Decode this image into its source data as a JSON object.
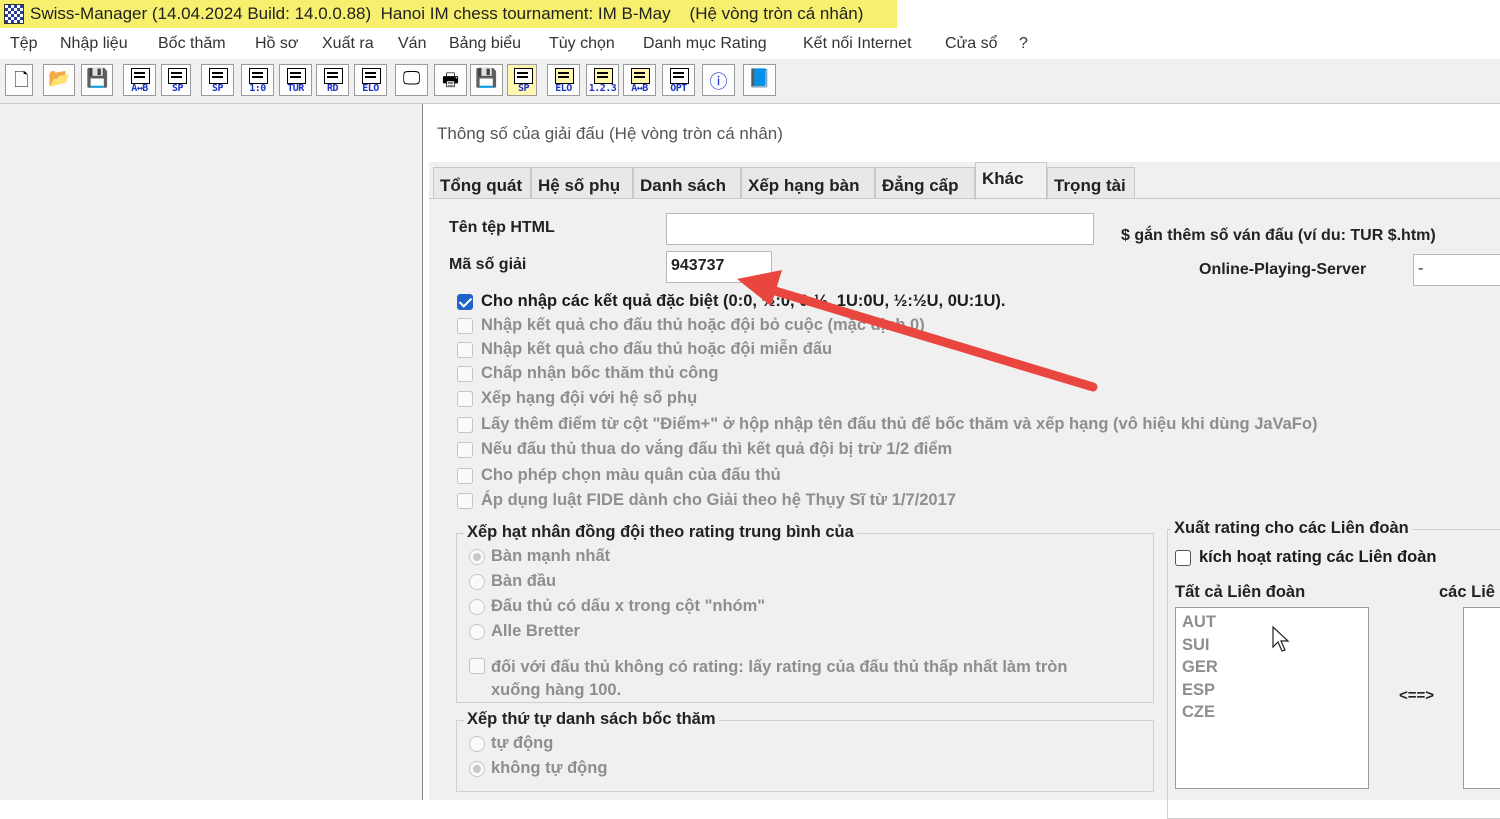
{
  "window": {
    "title": "Swiss-Manager (14.04.2024 Build: 14.0.0.88)  Hanoi IM chess tournament: IM B-May    (Hệ vòng tròn cá nhân)"
  },
  "menu": [
    "Tệp",
    "Nhập liệu",
    "Bốc thăm",
    "Hồ sơ",
    "Xuất ra",
    "Ván",
    "Bảng biểu",
    "Tùy chọn",
    "Danh mục Rating",
    "Kết nối Internet",
    "Cửa sổ",
    "?"
  ],
  "toolbar": {
    "captions": [
      "A↔B",
      "SP",
      "SP",
      "1:0",
      "TUR",
      "RD",
      "ELO",
      "SP",
      "ELO",
      "1.2.3",
      "A↔B",
      "OPT"
    ],
    "icons": [
      "new-file-icon",
      "open-folder-icon",
      "save-icon",
      "preview-icon",
      "print-icon",
      "save-icon",
      "info-icon",
      "help-book-icon"
    ]
  },
  "dialog": {
    "title": "Thông số của giải đấu (Hệ vòng tròn cá nhân)",
    "tabs": [
      "Tổng quát",
      "Hệ số phụ",
      "Danh sách",
      "Xếp hạng bàn",
      "Đẳng cấp",
      "Khác",
      "Trọng tài"
    ],
    "active_tab": "Khác",
    "html_file_label": "Tên tệp HTML",
    "html_file_value": "",
    "html_hint": "$  gắn thêm số ván đấu (ví du: TUR  $.htm)",
    "tournament_id_label": "Mã số giải",
    "tournament_id_value": "943737",
    "server_label": "Online-Playing-Server",
    "server_value": "-",
    "options": [
      {
        "label": "Cho nhập các kết quả đặc biệt (0:0, ½:0, 0:½, 1U:0U, ½:½U, 0U:1U).",
        "checked": true,
        "enabled": true
      },
      {
        "label": "Nhập kết quả cho đấu thủ hoặc đội bỏ cuộc (mặc định 0)",
        "checked": false,
        "enabled": false
      },
      {
        "label": "Nhập kết quả cho đấu thủ hoặc đội miễn đấu",
        "checked": false,
        "enabled": false
      },
      {
        "label": "Chấp nhận bốc thăm thủ công",
        "checked": false,
        "enabled": false
      },
      {
        "label": "Xếp hạng đội với hệ số phụ",
        "checked": false,
        "enabled": false
      },
      {
        "label": "Lấy thêm điểm từ cột \"Điểm+\" ở hộp nhập tên đấu thủ để bốc thăm và xếp hạng (vô hiệu khi  dùng JaVaFo)",
        "checked": false,
        "enabled": false
      },
      {
        "label": "Nếu đấu thủ thua do vắng đấu thì kết quả đội bị trừ 1/2 điểm",
        "checked": false,
        "enabled": false
      },
      {
        "label": "Cho phép chọn màu quân của đấu thủ",
        "checked": false,
        "enabled": false
      },
      {
        "label": "Áp dụng luật FIDE dành cho Giải theo hệ Thụy Sĩ từ 1/7/2017",
        "checked": false,
        "enabled": false
      }
    ],
    "team_rank_group": {
      "title": "Xếp hạt nhân đồng đội theo rating trung bình của",
      "radios": [
        "Bàn mạnh nhất",
        "Bàn đầu",
        "Đấu thủ có dấu x trong cột \"nhóm\"",
        "Alle Bretter"
      ],
      "selected": 0,
      "unrated_label_line1": "đối với đấu thủ không có rating: lấy rating của đấu thủ thấp nhất làm tròn",
      "unrated_label_line2": "xuống hàng 100."
    },
    "draw_order_group": {
      "title": "Xếp thứ tự danh sách bốc thăm",
      "radios": [
        "tự động",
        "không tự động"
      ],
      "selected": 1
    },
    "export_group": {
      "title": "Xuất rating cho các Liên đoàn",
      "activate_label": "kích hoạt rating các Liên đoàn",
      "all_label": "Tất cả Liên đoàn",
      "selected_label": "các Liê",
      "all_federations": [
        "AUT",
        "SUI",
        "GER",
        "ESP",
        "CZE"
      ],
      "move_label": "<==>"
    }
  },
  "colors": {
    "title_highlight": "#f7ef6e",
    "annotation_arrow": "#e8463f",
    "checkbox_accent": "#1f63c9"
  }
}
